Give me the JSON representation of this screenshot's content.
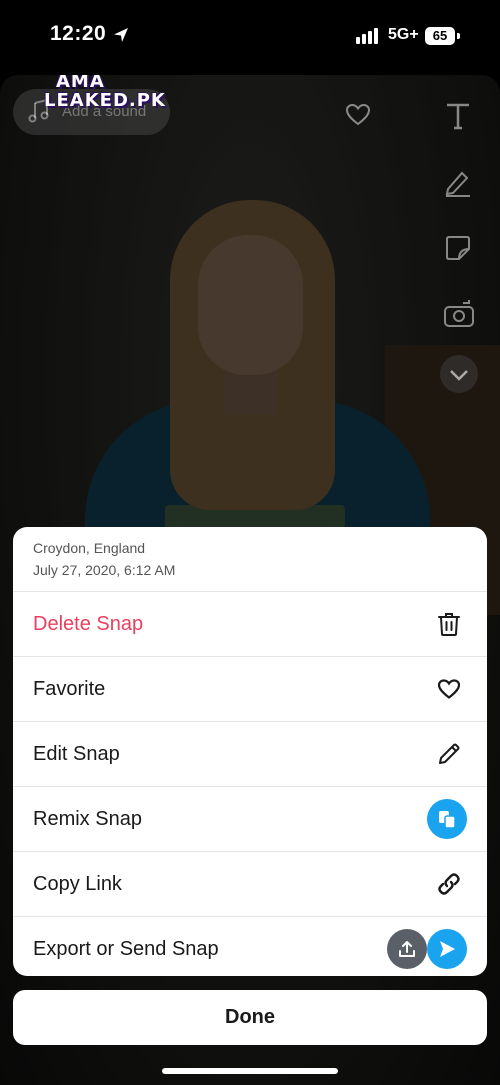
{
  "status_bar": {
    "time": "12:20",
    "network": "5G+",
    "battery": "65"
  },
  "watermark": {
    "line1": "AMA",
    "line2": "LEAKED.PK"
  },
  "editor": {
    "sound_placeholder": "Add a sound",
    "icons": [
      "music-note-icon",
      "heart-icon",
      "text-icon",
      "pencil-icon",
      "sticker-icon",
      "camera-flip-icon",
      "chevron-down-icon"
    ]
  },
  "sheet": {
    "location": "Croydon, England",
    "date": "July 27, 2020, 6:12 AM",
    "items": [
      {
        "label": "Delete Snap",
        "icon": "trash-icon",
        "color": "#e8405e"
      },
      {
        "label": "Favorite",
        "icon": "heart-icon"
      },
      {
        "label": "Edit Snap",
        "icon": "pencil-icon"
      },
      {
        "label": "Remix Snap",
        "icon": "remix-icon",
        "color": "#1aa3ee"
      },
      {
        "label": "Copy Link",
        "icon": "link-icon"
      },
      {
        "label": "Export or Send Snap",
        "icon": "export-icon"
      }
    ]
  },
  "done_label": "Done"
}
